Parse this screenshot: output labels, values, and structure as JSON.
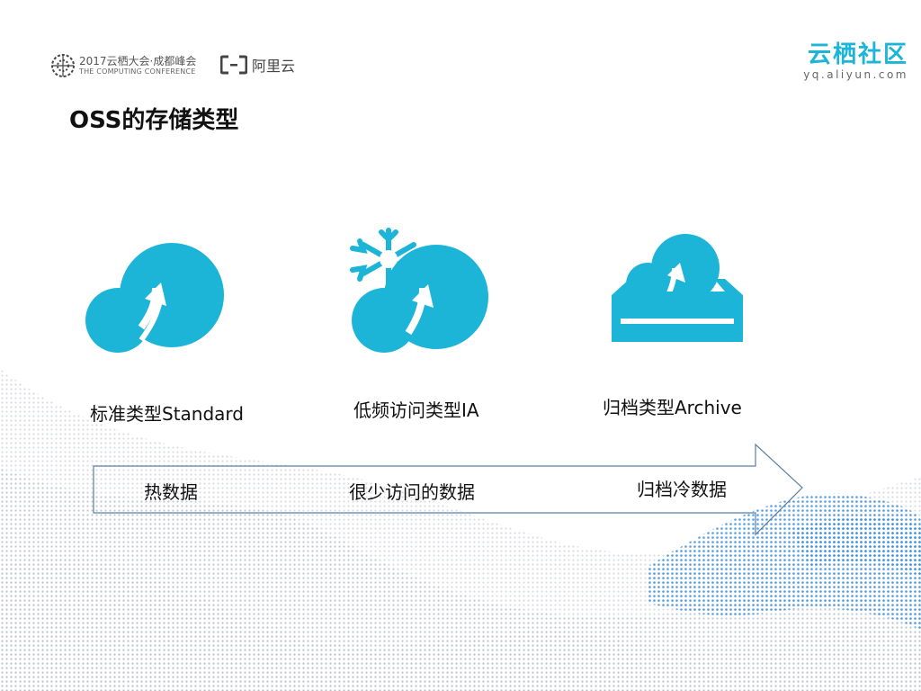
{
  "header": {
    "conference_title": "2017云栖大会·成都峰会",
    "conference_subtitle": "THE COMPUTING CONFERENCE",
    "aliyun_label": "阿里云",
    "community_name": "云栖社区",
    "community_url": "yq.aliyun.com"
  },
  "slide": {
    "title": "OSS的存储类型"
  },
  "storage_types": [
    {
      "label": "标准类型Standard",
      "icon": "cloud-upload-icon"
    },
    {
      "label": "低频访问类型IA",
      "icon": "snowflake-cloud-icon"
    },
    {
      "label": "归档类型Archive",
      "icon": "archive-tray-cloud-icon"
    }
  ],
  "data_arrow": {
    "labels": [
      "热数据",
      "很少访问的数据",
      "归档冷数据"
    ]
  },
  "colors": {
    "accent": "#1cb5d8",
    "arrow_stroke": "#5a7fa6",
    "wave_blue": "#3a8fe0"
  }
}
